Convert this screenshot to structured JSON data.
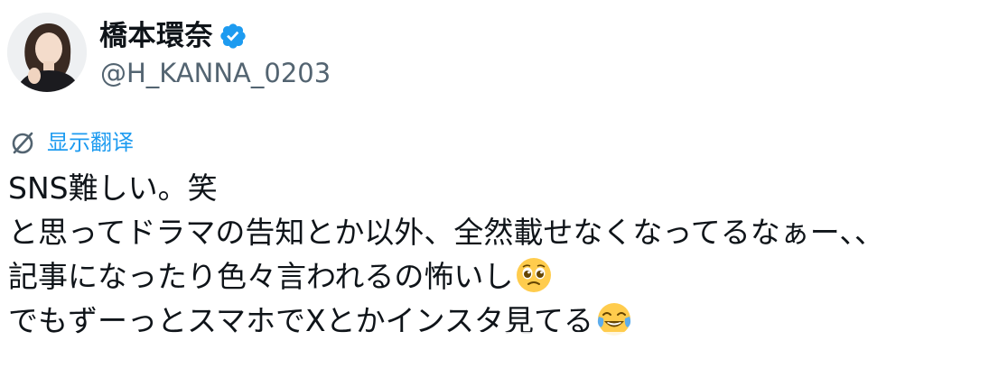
{
  "user": {
    "display_name": "橋本環奈",
    "handle": "@H_KANNA_0203",
    "verified_icon": "verified-badge-icon",
    "verified_color": "#1d9bf0",
    "avatar_icon": "profile-avatar"
  },
  "translate": {
    "icon": "globe-translate-icon",
    "label": "显示翻译",
    "color": "#1d9bf0"
  },
  "tweet": {
    "lines": [
      {
        "text": "SNS難しい。笑"
      },
      {
        "text": "と思ってドラマの告知とか以外、全然載せなくなってるなぁー、、"
      },
      {
        "text": "記事になったり色々言われるの怖いし",
        "emoji": "pleading-face-emoji"
      },
      {
        "text": "でもずーっとスマホでXとかインスタ見てる",
        "emoji": "tears-of-joy-emoji"
      }
    ]
  }
}
